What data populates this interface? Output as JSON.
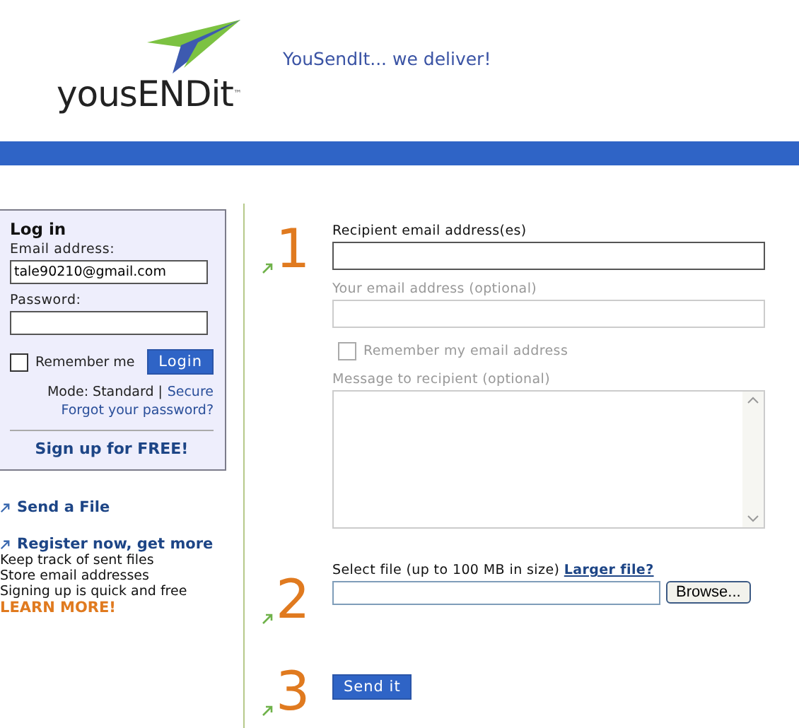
{
  "header": {
    "logo": "yousENDit",
    "trademark": "™",
    "tagline": "YouSendIt... we deliver!"
  },
  "login": {
    "title": "Log in",
    "email_label": "Email address:",
    "email_value": "tale90210@gmail.com",
    "password_label": "Password:",
    "remember": {
      "label": "Remember me",
      "checked": false
    },
    "login_button": "Login",
    "mode_label": "Mode: Standard |",
    "mode_link": "Secure",
    "forgot_link": "Forgot your password?",
    "signup": "Sign up for FREE!"
  },
  "sidebar": {
    "send_link": "Send a File",
    "register_link": "Register now, get more",
    "benefits": [
      "Keep track of sent files",
      "Store email addresses",
      "Signing up is quick and free"
    ],
    "learn_more": "LEARN MORE!"
  },
  "steps": [
    {
      "number": "1",
      "kind": "recipients",
      "recipient_label": "Recipient email address(es)",
      "sender_label": "Your email address (optional)",
      "remember": {
        "label": "Remember my email address",
        "checked": false,
        "disabled": true
      },
      "message_label": "Message to recipient (optional)"
    },
    {
      "number": "2",
      "kind": "file",
      "label": "Select file (up to 100 MB in size)",
      "link": "Larger file?",
      "browse": "Browse..."
    },
    {
      "number": "3",
      "kind": "send",
      "button": "Send it"
    }
  ]
}
